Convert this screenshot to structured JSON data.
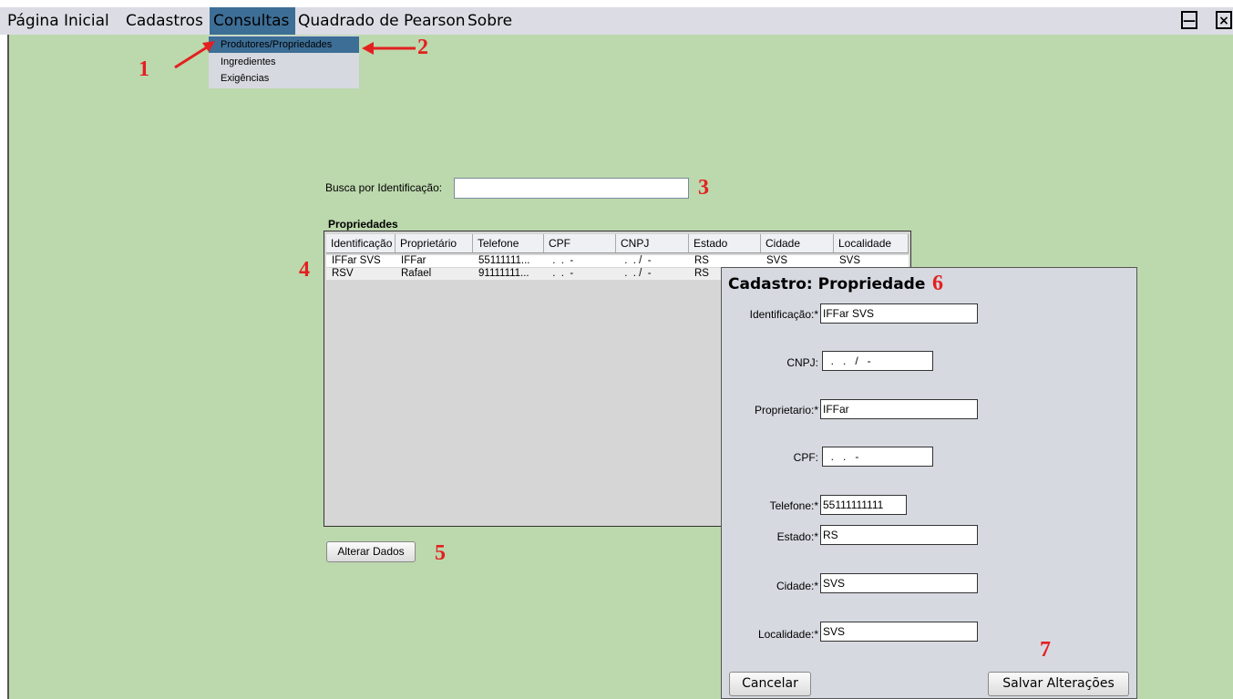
{
  "menu": {
    "items": [
      "Página Inicial",
      "Cadastros",
      "Consultas",
      "Quadrado de Pearson",
      "Sobre"
    ],
    "window_buttons": {
      "minimize": "—",
      "close": "×"
    }
  },
  "dropdown": {
    "items": [
      "Produtores/Propriedades",
      "Ingredientes",
      "Exigências"
    ]
  },
  "search": {
    "label": "Busca por Identificação:",
    "value": ""
  },
  "table": {
    "title": "Propriedades",
    "columns": [
      "Identificação",
      "Proprietário",
      "Telefone",
      "CPF",
      "CNPJ",
      "Estado",
      "Cidade",
      "Localidade"
    ],
    "rows": [
      [
        "IFFar SVS",
        "IFFar",
        "55111111...",
        " .  .  -",
        " .  . /  -",
        "RS",
        "SVS",
        "SVS"
      ],
      [
        "RSV",
        "Rafael",
        "91111111...",
        " .  .  -",
        " .  . /  -",
        "RS",
        "",
        ""
      ]
    ]
  },
  "alter_button": "Alterar Dados",
  "dialog": {
    "title": "Cadastro: Propriedade",
    "fields": [
      {
        "label": "Identificação:*",
        "value": "IFFar SVS"
      },
      {
        "label": "CNPJ:",
        "value": "  .   .   /   -"
      },
      {
        "label": "Proprietario:*",
        "value": "IFFar"
      },
      {
        "label": "CPF:",
        "value": "  .   .   -"
      },
      {
        "label": "Telefone:*",
        "value": "55111111111"
      },
      {
        "label": "Estado:*",
        "value": "RS"
      },
      {
        "label": "Cidade:*",
        "value": "SVS"
      },
      {
        "label": "Localidade:*",
        "value": "SVS"
      }
    ],
    "cancel": "Cancelar",
    "save": "Salvar Alterações"
  },
  "annotations": [
    "1",
    "2",
    "3",
    "4",
    "5",
    "6",
    "7"
  ],
  "colors": {
    "desktop": "#bcd8ad",
    "menu_highlight": "#3d6e96",
    "annotation": "#e32020"
  }
}
